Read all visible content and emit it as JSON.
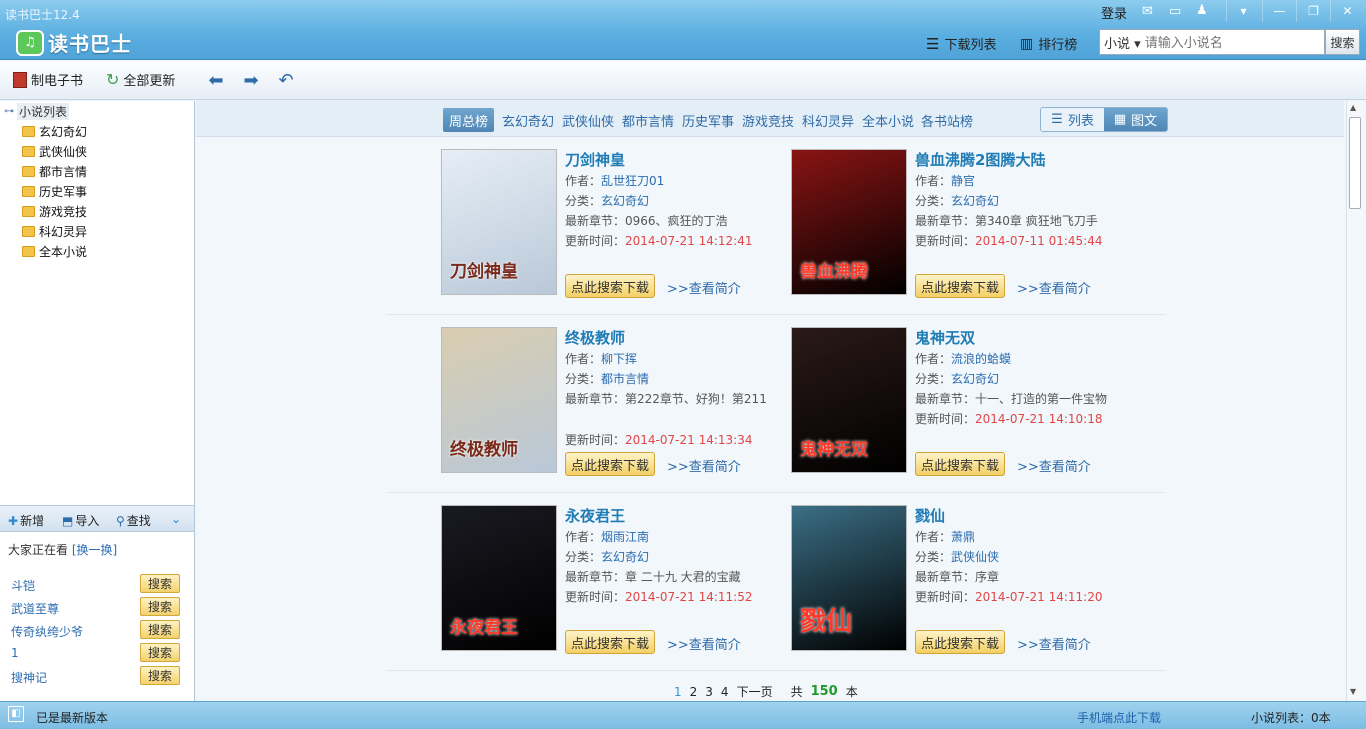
{
  "app": {
    "title": "读书巴士12.4",
    "logo_text": "读书巴士"
  },
  "topbar": {
    "login": "登录",
    "download_list": "下载列表",
    "ranking": "排行榜",
    "search_type": "小说",
    "search_placeholder": "请输入小说名",
    "search_button": "搜索"
  },
  "toolbar": {
    "make_ebook": "制电子书",
    "update_all": "全部更新"
  },
  "sidebar": {
    "root": "小说列表",
    "items": [
      "玄幻奇幻",
      "武侠仙侠",
      "都市言情",
      "历史军事",
      "游戏竞技",
      "科幻灵异",
      "全本小说"
    ],
    "tools": {
      "add": "新增",
      "import": "导入",
      "find": "查找"
    },
    "watching_label": "大家正在看",
    "watching_switch": "[换一换]",
    "hot": [
      {
        "name": "斗铠",
        "btn": "搜索"
      },
      {
        "name": "武道至尊",
        "btn": "搜索"
      },
      {
        "name": "传奇纨绔少爷",
        "btn": "搜索"
      },
      {
        "name": "1",
        "btn": "搜索"
      },
      {
        "name": "搜神记",
        "btn": "搜索"
      }
    ]
  },
  "filters": [
    "周总榜",
    "玄幻奇幻",
    "武侠仙侠",
    "都市言情",
    "历史军事",
    "游戏竞技",
    "科幻灵异",
    "全本小说",
    "各书站榜"
  ],
  "view": {
    "list": "列表",
    "grid": "图文"
  },
  "labels": {
    "author": "作者：",
    "category": "分类：",
    "latest": "最新章节：",
    "updated": "更新时间：",
    "download": "点此搜索下载",
    "intro": ">>查看简介"
  },
  "books": [
    {
      "title": "刀剑神皇",
      "author": "乱世狂刀01",
      "category": "玄幻奇幻",
      "latest": "0966、疯狂的丁浩",
      "updated": "2014-07-21 14:12:41",
      "cover_text": "刀剑神皇",
      "cover_color": "#e6eef6"
    },
    {
      "title": "兽血沸腾2图腾大陆",
      "author": "静官",
      "category": "玄幻奇幻",
      "latest": "第340章 疯狂地飞刀手",
      "updated": "2014-07-11 01:45:44",
      "cover_text": "兽血沸腾",
      "cover_color": "#8a1414"
    },
    {
      "title": "终极教师",
      "author": "柳下挥",
      "category": "都市言情",
      "latest": "第222章节、好狗！第211",
      "updated": "2014-07-21 14:13:34",
      "cover_text": "终极教师",
      "cover_color": "#d9cdb0"
    },
    {
      "title": "鬼神无双",
      "author": "流浪的蛤蟆",
      "category": "玄幻奇幻",
      "latest": "十一、打造的第一件宝物",
      "updated": "2014-07-21 14:10:18",
      "cover_text": "鬼神无双",
      "cover_color": "#2a1a18"
    },
    {
      "title": "永夜君王",
      "author": "烟雨江南",
      "category": "玄幻奇幻",
      "latest": "章 二十九 大君的宝藏",
      "updated": "2014-07-21 14:11:52",
      "cover_text": "永夜君王",
      "cover_color": "#1a1a22"
    },
    {
      "title": "戮仙",
      "author": "萧鼎",
      "category": "武侠仙侠",
      "latest": "序章",
      "updated": "2014-07-21 14:11:20",
      "cover_text": "戮仙",
      "cover_color": "#3b6f86"
    }
  ],
  "pager": {
    "pages": [
      "1",
      "2",
      "3",
      "4"
    ],
    "next": "下一页",
    "total_prefix": "共",
    "total": "150",
    "total_suffix": "本"
  },
  "status": {
    "version": "已是最新版本",
    "mobile": "手机端点此下载",
    "count": "小说列表：0本"
  }
}
